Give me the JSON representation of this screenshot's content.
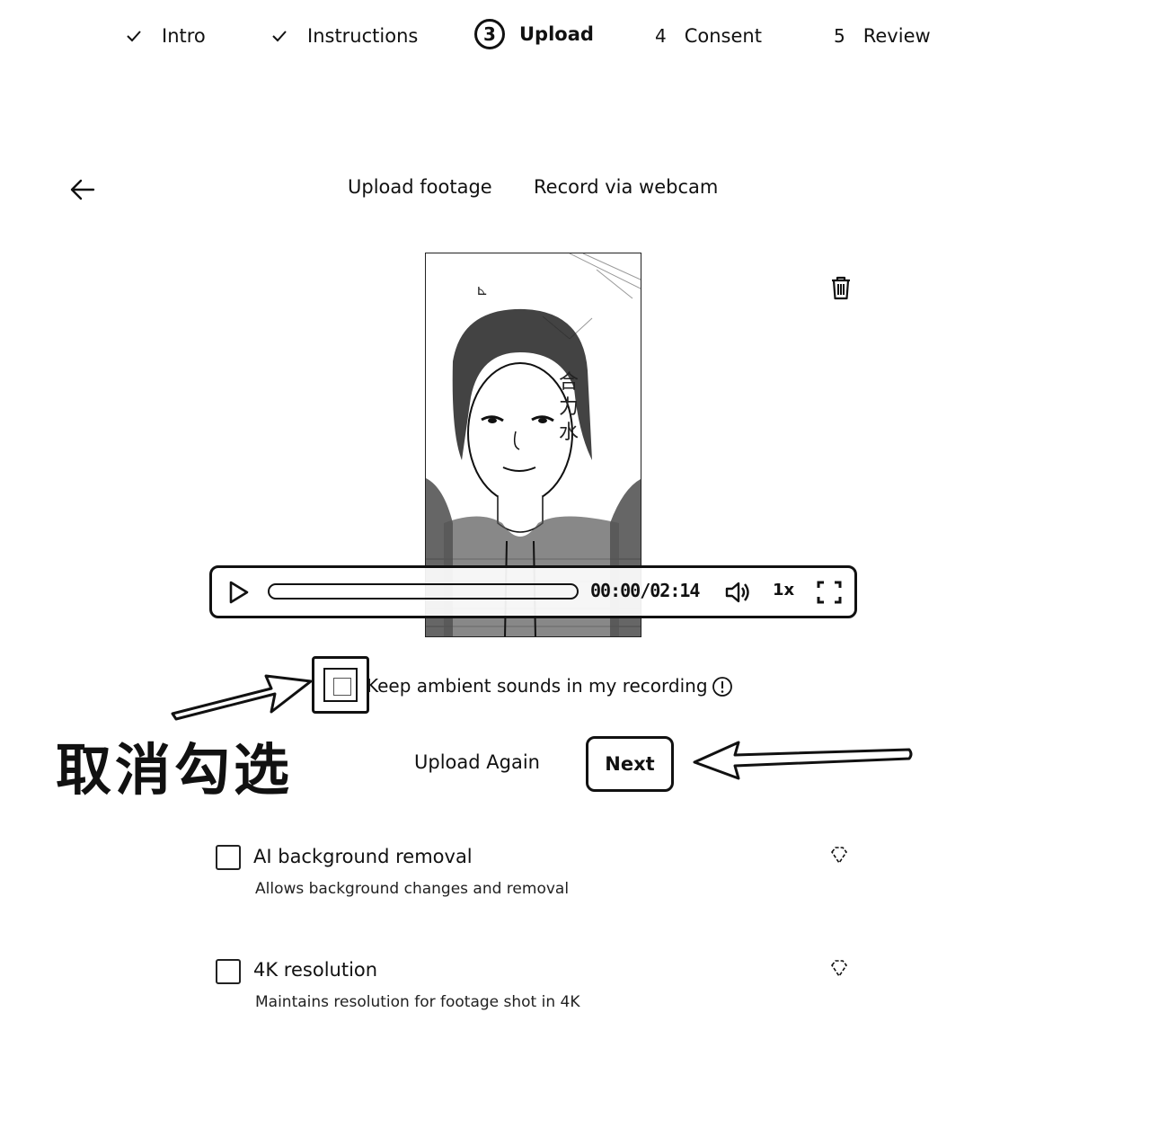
{
  "stepper": {
    "steps": [
      {
        "number": "",
        "label": "Intro",
        "state": "done",
        "icon": "check-icon"
      },
      {
        "number": "",
        "label": "Instructions",
        "state": "done",
        "icon": "check-icon"
      },
      {
        "number": "3",
        "label": "Upload",
        "state": "active"
      },
      {
        "number": "4",
        "label": "Consent",
        "state": "pending"
      },
      {
        "number": "5",
        "label": "Review",
        "state": "pending"
      }
    ]
  },
  "nav": {
    "back_icon": "arrow-left-icon"
  },
  "tabs": {
    "upload": "Upload footage",
    "webcam": "Record via webcam"
  },
  "player": {
    "time": "00:00/02:14",
    "speed": "1x",
    "progress": 0.0,
    "icons": [
      "play-icon",
      "volume-icon",
      "fullscreen-icon",
      "trash-icon"
    ]
  },
  "ambient": {
    "label": "Keep ambient sounds in my recording",
    "checked": false
  },
  "annotation": {
    "text": "取消勾选"
  },
  "actions": {
    "upload_again": "Upload Again",
    "next": "Next"
  },
  "options": [
    {
      "title": "AI background removal",
      "description": "Allows background changes and removal",
      "checked": false
    },
    {
      "title": "4K resolution",
      "description": "Maintains resolution for footage shot in 4K",
      "checked": false
    }
  ]
}
